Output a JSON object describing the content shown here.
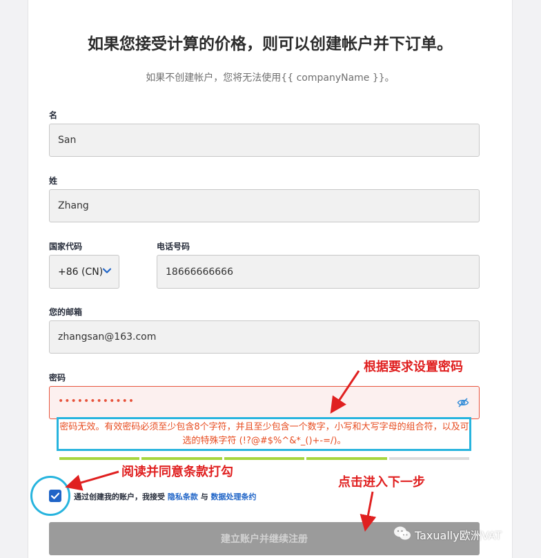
{
  "header": {
    "title": "如果您接受计算的价格，则可以创建帐户并下订单。",
    "subtitle": "如果不创建帐户，您将无法使用{{ companyName }}。"
  },
  "form": {
    "first_name": {
      "label": "名",
      "value": "San"
    },
    "last_name": {
      "label": "姓",
      "value": "Zhang"
    },
    "country_code": {
      "label": "国家代码",
      "value": "+86 (CN)"
    },
    "phone": {
      "label": "电话号码",
      "value": "18666666666"
    },
    "email": {
      "label": "您的邮箱",
      "value": "zhangsan@163.com"
    },
    "password": {
      "label": "密码",
      "masked_value": "••••••••••••",
      "error": "密码无效。有效密码必须至少包含8个字符，并且至少包含一个数字，小写和大写字母的组合符，以及可选的特殊字符 (!?@#$%^&*_()+-=/)。",
      "strength_filled_segments": 4,
      "strength_total_segments": 5
    },
    "terms": {
      "checked": true,
      "prefix": "通过创建我的账户，我接受",
      "privacy_link": "隐私条款",
      "conjunction": "与",
      "data_link": "数据处理条约"
    },
    "submit_label": "建立账户并继续注册"
  },
  "annotations": {
    "password_note": "根据要求设置密码",
    "terms_note": "阅读并同意条款打勾",
    "next_note": "点击进入下一步"
  },
  "watermark": {
    "text": "Taxually欧洲VAT"
  },
  "colors": {
    "error": "#e7543d",
    "link": "#1f64c7",
    "strength_filled": "#a6d63f",
    "strength_empty": "#dcdcdc",
    "annotation": "#e02020",
    "highlight": "#27b4de"
  }
}
